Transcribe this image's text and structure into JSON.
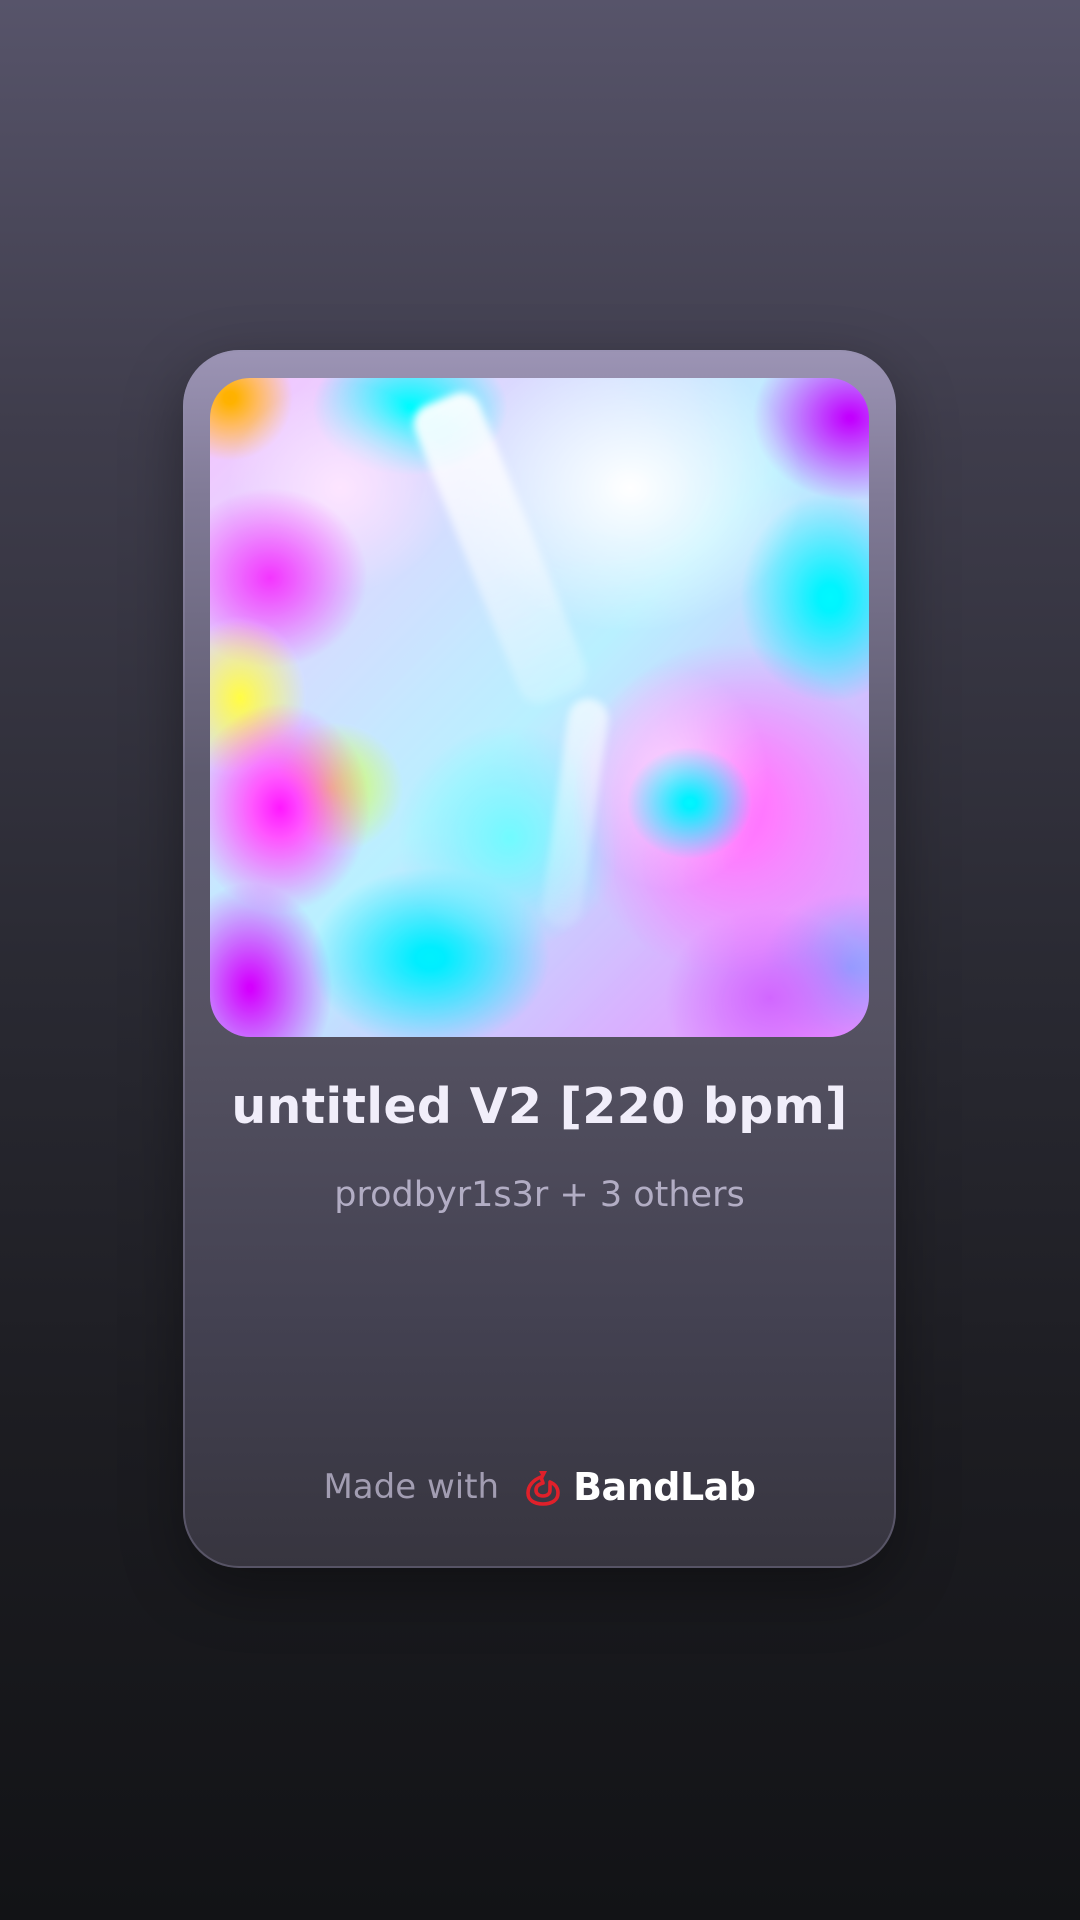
{
  "track": {
    "title": "untitled V2 [220 bpm]",
    "artists": "prodbyr1s3r + 3 others"
  },
  "footer": {
    "made_with": "Made with",
    "brand_name": "BandLab",
    "brand_icon": "bandlab-logo-icon",
    "brand_color": "#e0202a"
  }
}
